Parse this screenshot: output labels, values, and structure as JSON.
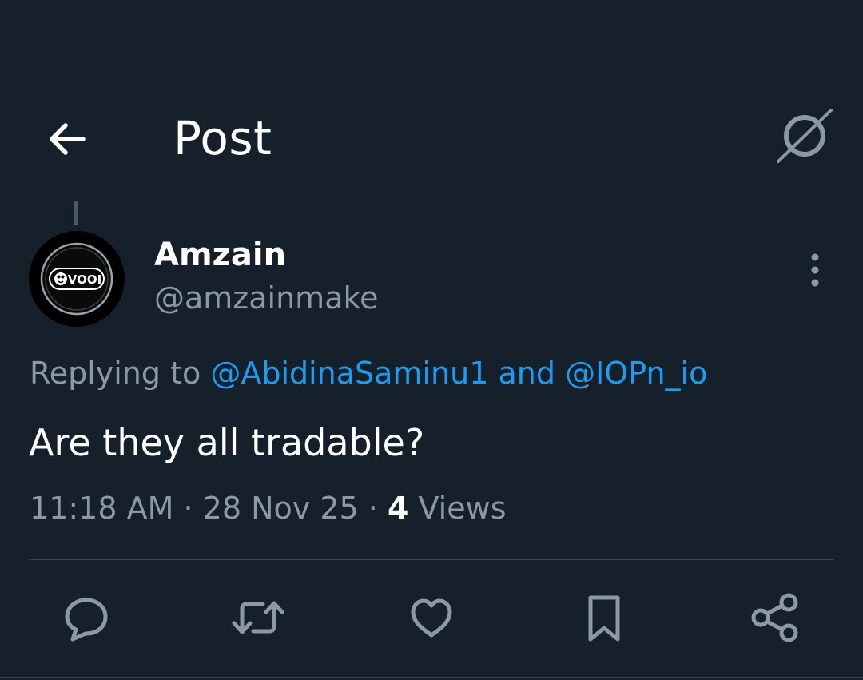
{
  "header": {
    "title": "Post",
    "back_icon": "arrow-left-icon",
    "hide_icon": "slashed-circle-icon"
  },
  "author": {
    "display_name": "Amzain",
    "handle": "@amzainmake",
    "avatar_label": "VOOI"
  },
  "reply_context": {
    "prefix": "Replying to",
    "mentions": [
      "@AbidinaSaminu1",
      "@IOPn_io"
    ],
    "joiner": "and"
  },
  "tweet": {
    "text": "Are they all tradable?"
  },
  "meta": {
    "time": "11:18 AM",
    "date": "28 Nov 25",
    "separator": "·",
    "views_count": "4",
    "views_label": "Views"
  },
  "actions": [
    {
      "name": "reply",
      "icon": "speech-bubble-icon"
    },
    {
      "name": "repost",
      "icon": "repost-arrows-icon"
    },
    {
      "name": "like",
      "icon": "heart-icon"
    },
    {
      "name": "bookmark",
      "icon": "bookmark-icon"
    },
    {
      "name": "share",
      "icon": "share-nodes-icon"
    }
  ],
  "colors": {
    "background": "#15202b",
    "text_primary": "#ffffff",
    "text_secondary": "#8b98a5",
    "accent": "#1d9bf0",
    "border": "#38444d"
  }
}
